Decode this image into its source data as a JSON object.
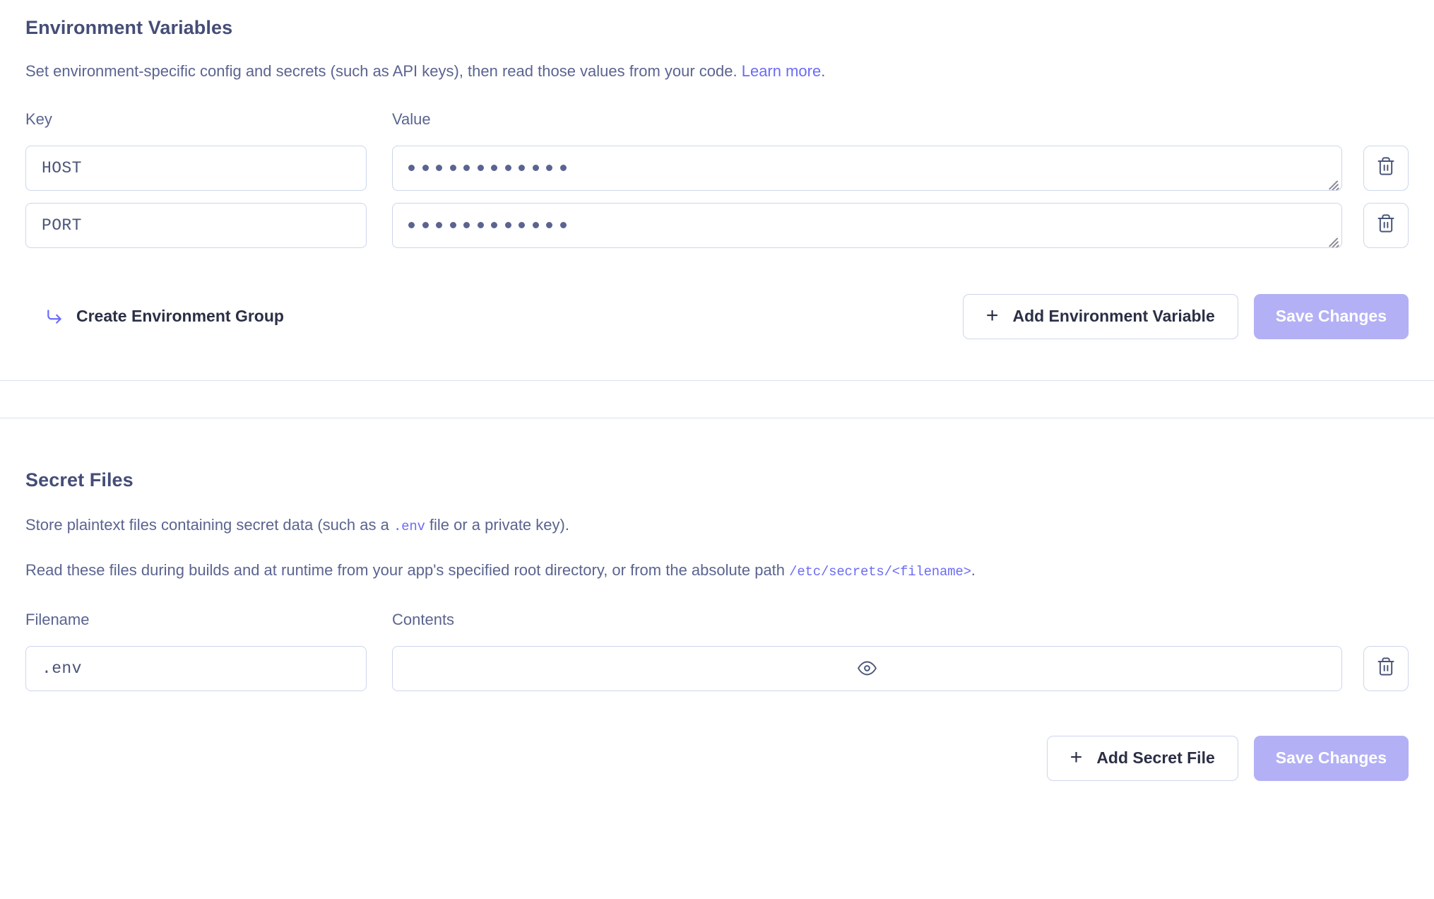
{
  "env_section": {
    "title": "Environment Variables",
    "desc_prefix": "Set environment-specific config and secrets (such as API keys), then read those values from your code. ",
    "desc_link": "Learn more",
    "desc_suffix": ".",
    "headers": {
      "key": "Key",
      "value": "Value"
    },
    "rows": [
      {
        "key": "HOST",
        "value_masked": "••••••••••••",
        "value_dots": 12
      },
      {
        "key": "PORT",
        "value_masked": "••••••••••••",
        "value_dots": 12
      }
    ],
    "create_group_label": "Create Environment Group",
    "add_label": "Add Environment Variable",
    "save_label": "Save Changes",
    "delete_icon": "trash-icon",
    "add_icon": "plus-icon",
    "create_group_icon": "corner-down-right-arrow-icon"
  },
  "secret_section": {
    "title": "Secret Files",
    "desc1_part1": "Store plaintext files containing secret data (such as a ",
    "desc1_code": ".env",
    "desc1_part2": " file or a private key).",
    "desc2_part1": "Read these files during builds and at runtime from your app's specified root directory, or from the absolute path ",
    "desc2_code": "/etc/secrets/<filename>",
    "desc2_part2": ".",
    "headers": {
      "filename": "Filename",
      "contents": "Contents"
    },
    "rows": [
      {
        "filename": ".env",
        "contents": "",
        "reveal_icon": "eye-icon"
      }
    ],
    "add_label": "Add Secret File",
    "save_label": "Save Changes",
    "delete_icon": "trash-icon",
    "add_icon": "plus-icon"
  },
  "colors": {
    "heading": "#454d77",
    "body_text": "#5b6490",
    "link": "#6b6cf6",
    "border": "#ccd6ea",
    "divider": "#d7e0f0",
    "primary_disabled": "#b3b0f5",
    "button_text": "#2b2f45"
  }
}
